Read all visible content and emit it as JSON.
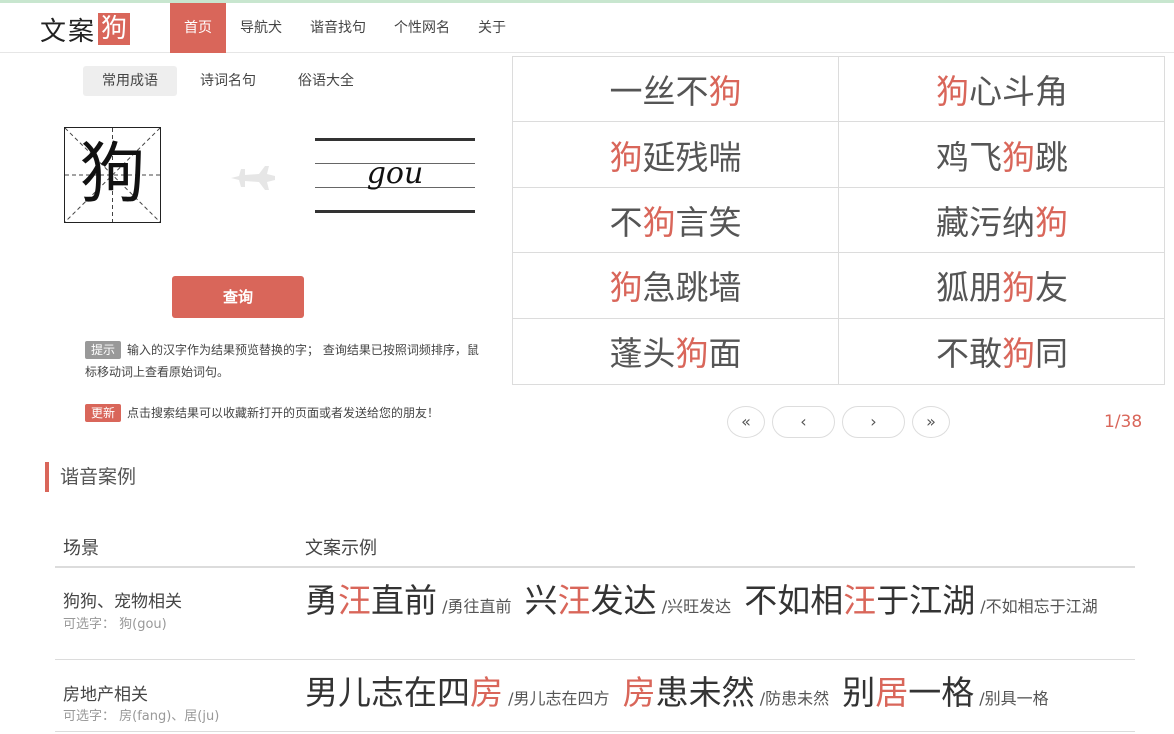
{
  "logo": {
    "text": "文案",
    "box": "狗"
  },
  "nav": [
    {
      "label": "首页",
      "active": true
    },
    {
      "label": "导航犬",
      "active": false
    },
    {
      "label": "谐音找句",
      "active": false
    },
    {
      "label": "个性网名",
      "active": false
    },
    {
      "label": "关于",
      "active": false
    }
  ],
  "subtabs": [
    {
      "label": "常用成语",
      "active": true
    },
    {
      "label": "诗词名句",
      "active": false
    },
    {
      "label": "俗语大全",
      "active": false
    }
  ],
  "preview": {
    "char": "狗",
    "pinyin": "gou"
  },
  "query_button": "查询",
  "tip": {
    "badge": "提示",
    "text": "输入的汉字作为结果预览替换的字； 查询结果已按照词频排序，鼠标移动词上查看原始词句。"
  },
  "update": {
    "badge": "更新",
    "text": "点击搜索结果可以收藏新打开的页面或者发送给您的朋友！"
  },
  "results": [
    {
      "pre": "一丝不",
      "hl": "狗",
      "post": ""
    },
    {
      "pre": "",
      "hl": "狗",
      "post": "心斗角"
    },
    {
      "pre": "",
      "hl": "狗",
      "post": "延残喘"
    },
    {
      "pre": "鸡飞",
      "hl": "狗",
      "post": "跳"
    },
    {
      "pre": "不",
      "hl": "狗",
      "post": "言笑"
    },
    {
      "pre": "藏污纳",
      "hl": "狗",
      "post": ""
    },
    {
      "pre": "",
      "hl": "狗",
      "post": "急跳墙"
    },
    {
      "pre": "狐朋",
      "hl": "狗",
      "post": "友"
    },
    {
      "pre": "蓬头",
      "hl": "狗",
      "post": "面"
    },
    {
      "pre": "不敢",
      "hl": "狗",
      "post": "同"
    }
  ],
  "pager": {
    "first": "«",
    "prev": "‹",
    "next": "›",
    "last": "»",
    "info": "1/38"
  },
  "section_title": "谐音案例",
  "table": {
    "headers": {
      "scene": "场景",
      "examples": "文案示例"
    },
    "rows": [
      {
        "scene": "狗狗、宠物相关",
        "options": "可选字： 狗(gou)",
        "examples": [
          {
            "pre": "勇",
            "hl": "汪",
            "post": "直前",
            "orig": "/勇往直前"
          },
          {
            "pre": "兴",
            "hl": "汪",
            "post": "发达",
            "orig": "/兴旺发达"
          },
          {
            "pre": "不如相",
            "hl": "汪",
            "post": "于江湖",
            "orig": "/不如相忘于江湖"
          }
        ]
      },
      {
        "scene": "房地产相关",
        "options": "可选字： 房(fang)、居(ju)",
        "examples": [
          {
            "pre": "男儿志在四",
            "hl": "房",
            "post": "",
            "orig": "/男儿志在四方"
          },
          {
            "pre": "",
            "hl": "房",
            "post": "患未然",
            "orig": "/防患未然"
          },
          {
            "pre": "别",
            "hl": "居",
            "post": "一格",
            "orig": "/别具一格"
          }
        ]
      }
    ]
  },
  "colors": {
    "accent": "#d9665a",
    "muted_badge": "#999999",
    "border": "#dcdcdc"
  }
}
